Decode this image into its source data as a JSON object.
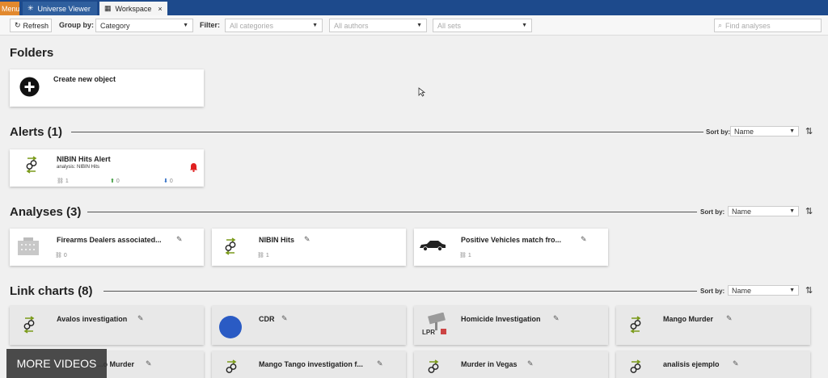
{
  "tabs": {
    "menu": "Menu",
    "universe": "Universe Viewer",
    "workspace": "Workspace",
    "workspace_close": "×"
  },
  "toolbar": {
    "refresh": "Refresh",
    "group_by_label": "Group by:",
    "group_by_value": "Category",
    "filter_label": "Filter:",
    "filter_categories": "All categories",
    "filter_authors": "All authors",
    "filter_sets": "All sets",
    "search_placeholder": "Find analyses"
  },
  "folders": {
    "heading": "Folders",
    "create": "Create new object"
  },
  "alerts": {
    "heading": "Alerts (1)",
    "sort_label": "Sort by:",
    "sort_value": "Name",
    "items": [
      {
        "title": "NIBIN Hits Alert",
        "sub": "analysis: NIBIN Hits",
        "count": "1",
        "up": "0",
        "down": "0"
      }
    ]
  },
  "analyses": {
    "heading": "Analyses (3)",
    "sort_label": "Sort by:",
    "sort_value": "Name",
    "items": [
      {
        "title": "Firearms Dealers associated...",
        "count": "0"
      },
      {
        "title": "NIBIN Hits",
        "count": "1"
      },
      {
        "title": "Positive Vehicles match fro...",
        "count": "1"
      }
    ]
  },
  "linkcharts": {
    "heading": "Link charts (8)",
    "sort_label": "Sort by:",
    "sort_value": "Name",
    "items": [
      {
        "title": "Avalos investigation"
      },
      {
        "title": "CDR"
      },
      {
        "title": "Homicide Investigation",
        "badge": "LPR"
      },
      {
        "title": "Mango Murder"
      },
      {
        "title": "...o Murder"
      },
      {
        "title": "Mango Tango investigation f..."
      },
      {
        "title": "Murder in Vegas"
      },
      {
        "title": "analisis ejemplo"
      }
    ]
  },
  "overlay": {
    "more_videos": "MORE VIDEOS"
  },
  "colors": {
    "tabbar": "#1d4a8c",
    "menu_tab": "#e2892e",
    "bell": "#e02020",
    "cdr_circle": "#2a5bc4"
  }
}
